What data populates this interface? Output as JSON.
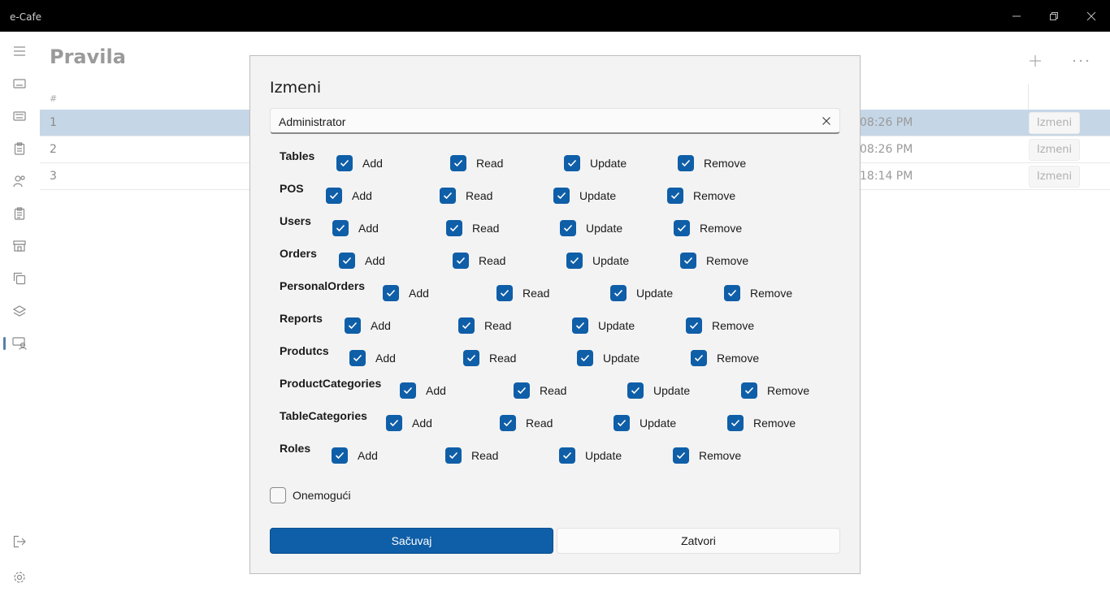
{
  "window": {
    "title": "e-Cafe",
    "buttons": [
      "minimize-icon",
      "restore-icon",
      "close-icon"
    ]
  },
  "sidebar": {
    "icons": [
      "hamburger-menu-icon",
      "keyboard-icon",
      "keyboard-alt-icon",
      "clipboard-icon",
      "people-icon",
      "clipboard-list-icon",
      "store-icon",
      "copy-icon",
      "layers-icon",
      "person-desk-icon"
    ],
    "bottom_icons": [
      "sign-out-icon",
      "settings-icon"
    ],
    "selected": "person-desk-icon"
  },
  "page": {
    "title": "Pravila",
    "add_icon": "plus-icon",
    "more_icon": "more-icon"
  },
  "grid": {
    "header_hash": "#",
    "rows": [
      {
        "num": "1",
        "time": "08:26 PM",
        "action": "Izmeni",
        "selected": true
      },
      {
        "num": "2",
        "time": "08:26 PM",
        "action": "Izmeni",
        "selected": false
      },
      {
        "num": "3",
        "time": "18:14 PM",
        "action": "Izmeni",
        "selected": false
      }
    ]
  },
  "dialog": {
    "title": "Izmeni",
    "name_value": "Administrator",
    "clear_icon": "close-icon",
    "permission_labels": {
      "add": "Add",
      "read": "Read",
      "update": "Update",
      "remove": "Remove"
    },
    "permissions": [
      {
        "name": "Tables",
        "add": true,
        "read": true,
        "update": true,
        "remove": true
      },
      {
        "name": "POS",
        "add": true,
        "read": true,
        "update": true,
        "remove": true
      },
      {
        "name": "Users",
        "add": true,
        "read": true,
        "update": true,
        "remove": true
      },
      {
        "name": "Orders",
        "add": true,
        "read": true,
        "update": true,
        "remove": true
      },
      {
        "name": "PersonalOrders",
        "add": true,
        "read": true,
        "update": true,
        "remove": true
      },
      {
        "name": "Reports",
        "add": true,
        "read": true,
        "update": true,
        "remove": true
      },
      {
        "name": "Produtcs",
        "add": true,
        "read": true,
        "update": true,
        "remove": true
      },
      {
        "name": "ProductCategories",
        "add": true,
        "read": true,
        "update": true,
        "remove": true
      },
      {
        "name": "TableCategories",
        "add": true,
        "read": true,
        "update": true,
        "remove": true
      },
      {
        "name": "Roles",
        "add": true,
        "read": true,
        "update": true,
        "remove": true
      }
    ],
    "disable_label": "Onemogući",
    "disable_checked": false,
    "save_label": "Sačuvaj",
    "close_label": "Zatvori"
  },
  "colors": {
    "accent": "#0f5ea8",
    "selected_row": "#c5d6e6",
    "titlebar": "#000000"
  }
}
